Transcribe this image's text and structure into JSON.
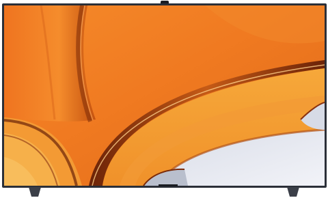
{
  "image": {
    "subject": "television",
    "screen_content": "wallpaper",
    "colors": {
      "background": "#ffffff",
      "bezel": "#2b2f38",
      "screen_orange": "#f07a21",
      "screen_deep": "#b4420d",
      "screen_yellow": "#f6a83a",
      "screen_light": "#e9ecf4",
      "stand": "#3b3f48",
      "camera": "#1a1c22"
    }
  }
}
